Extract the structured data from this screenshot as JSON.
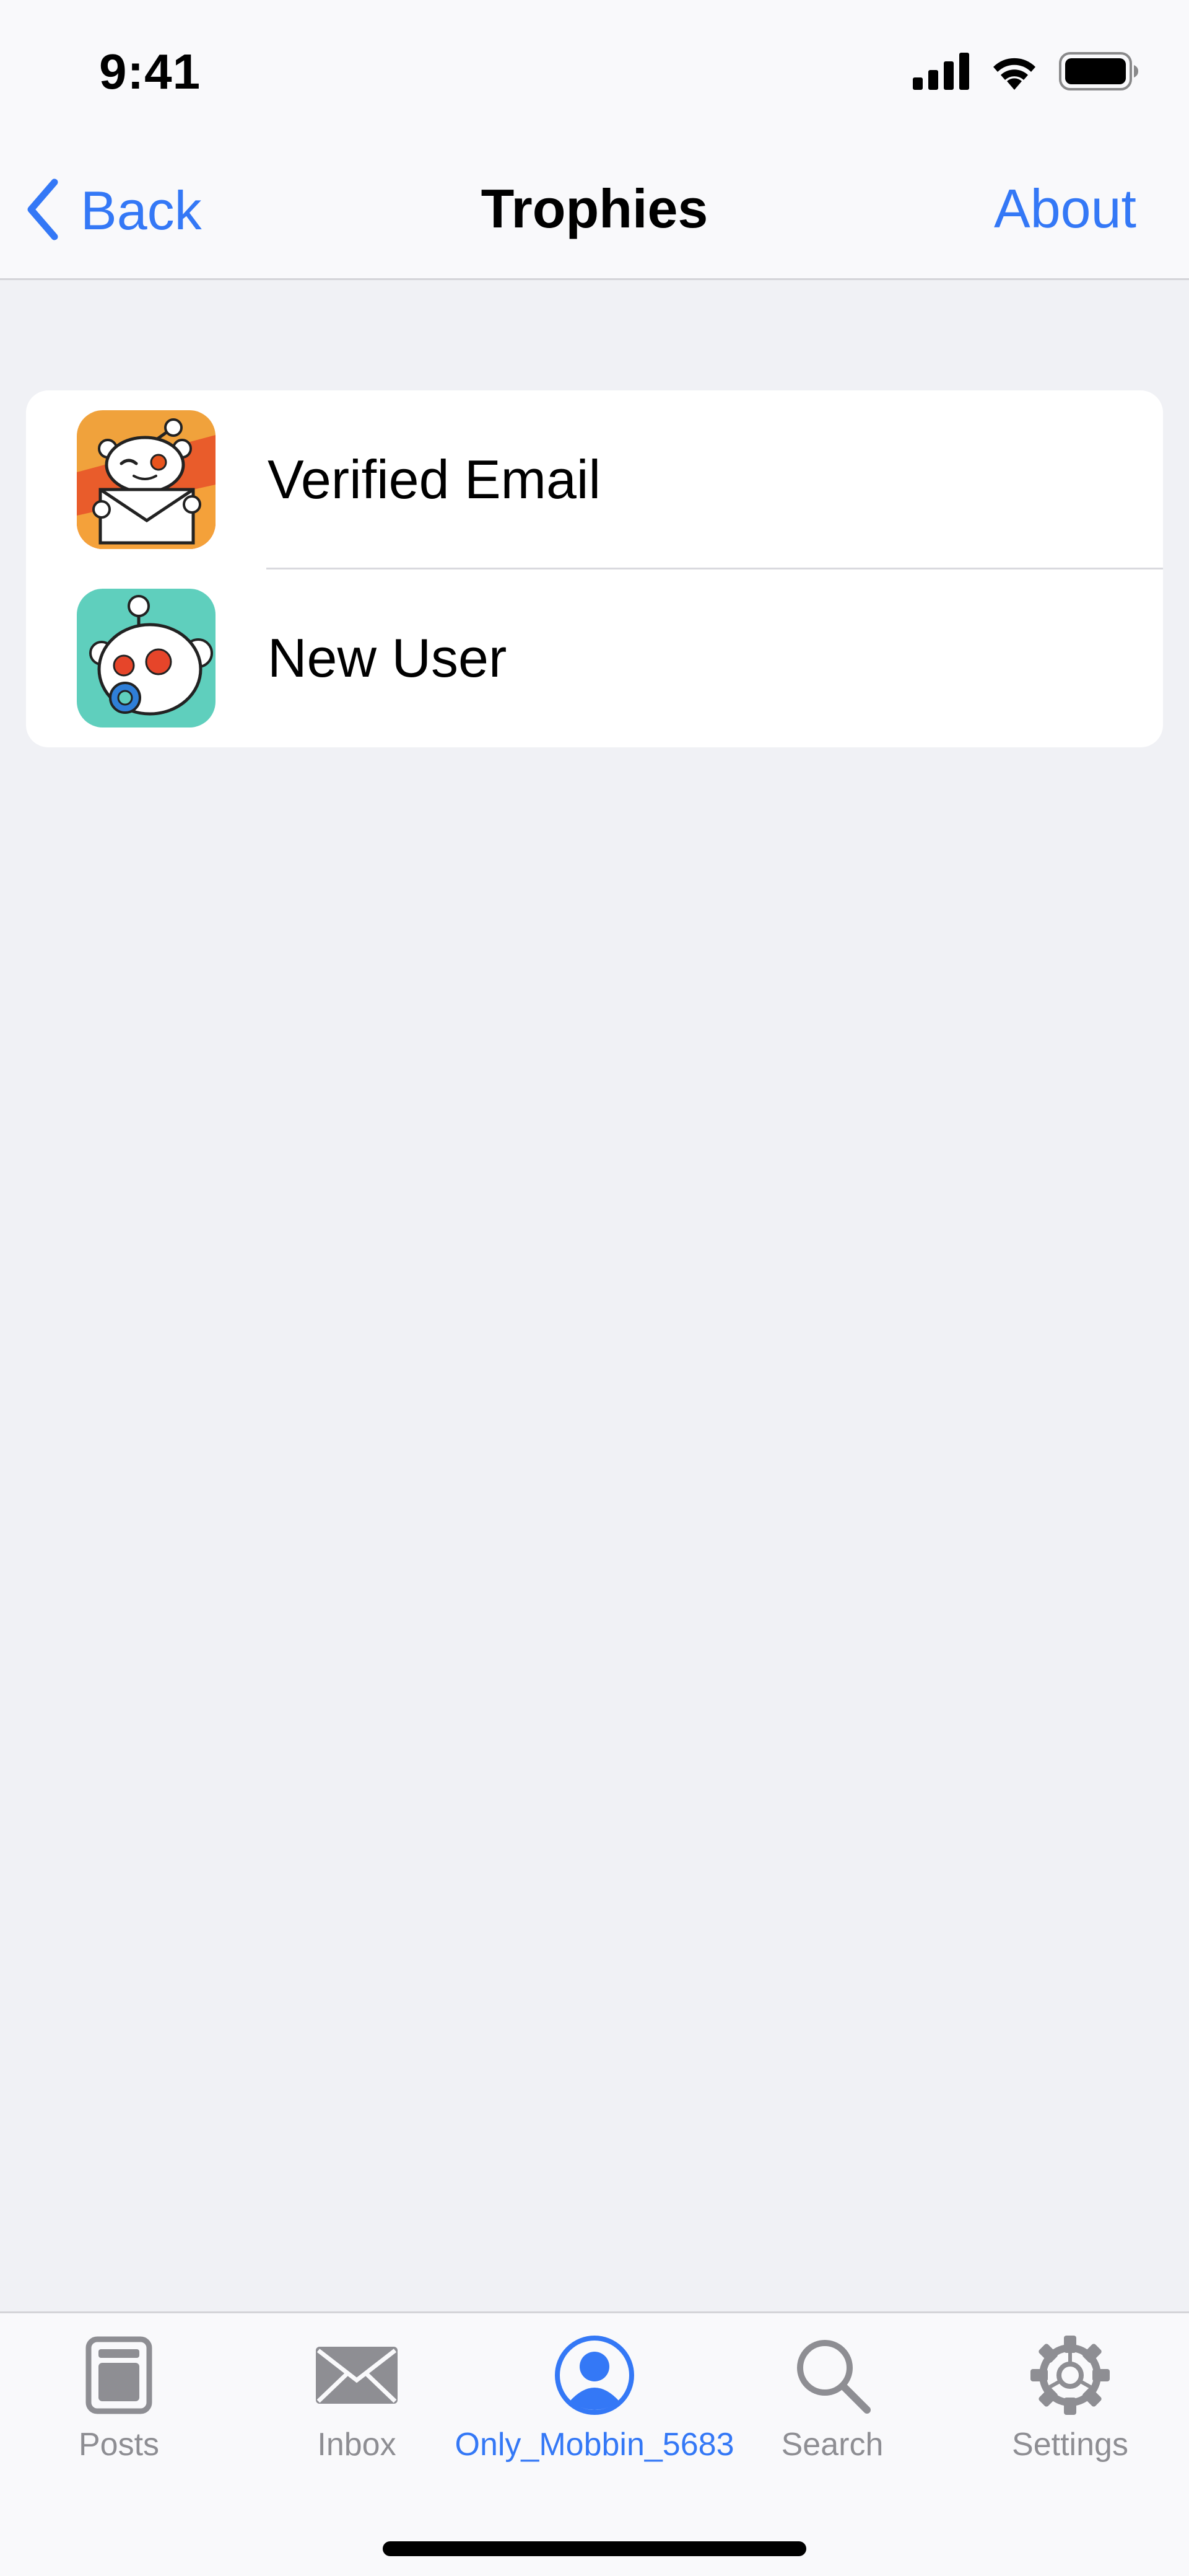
{
  "status_bar": {
    "time": "9:41"
  },
  "nav": {
    "back_label": "Back",
    "title": "Trophies",
    "about_label": "About"
  },
  "trophies": [
    {
      "label": "Verified Email",
      "icon": "verified-email-trophy-icon"
    },
    {
      "label": "New User",
      "icon": "new-user-trophy-icon"
    }
  ],
  "tabs": [
    {
      "label": "Posts",
      "icon": "posts-icon"
    },
    {
      "label": "Inbox",
      "icon": "inbox-icon"
    },
    {
      "label": "Only_Mobbin_5683",
      "icon": "profile-icon",
      "active": true
    },
    {
      "label": "Search",
      "icon": "search-icon"
    },
    {
      "label": "Settings",
      "icon": "settings-gear-icon"
    }
  ],
  "colors": {
    "accent": "#3478f6",
    "background": "#f0f1f5",
    "inactive_tab": "#8e8e93"
  }
}
